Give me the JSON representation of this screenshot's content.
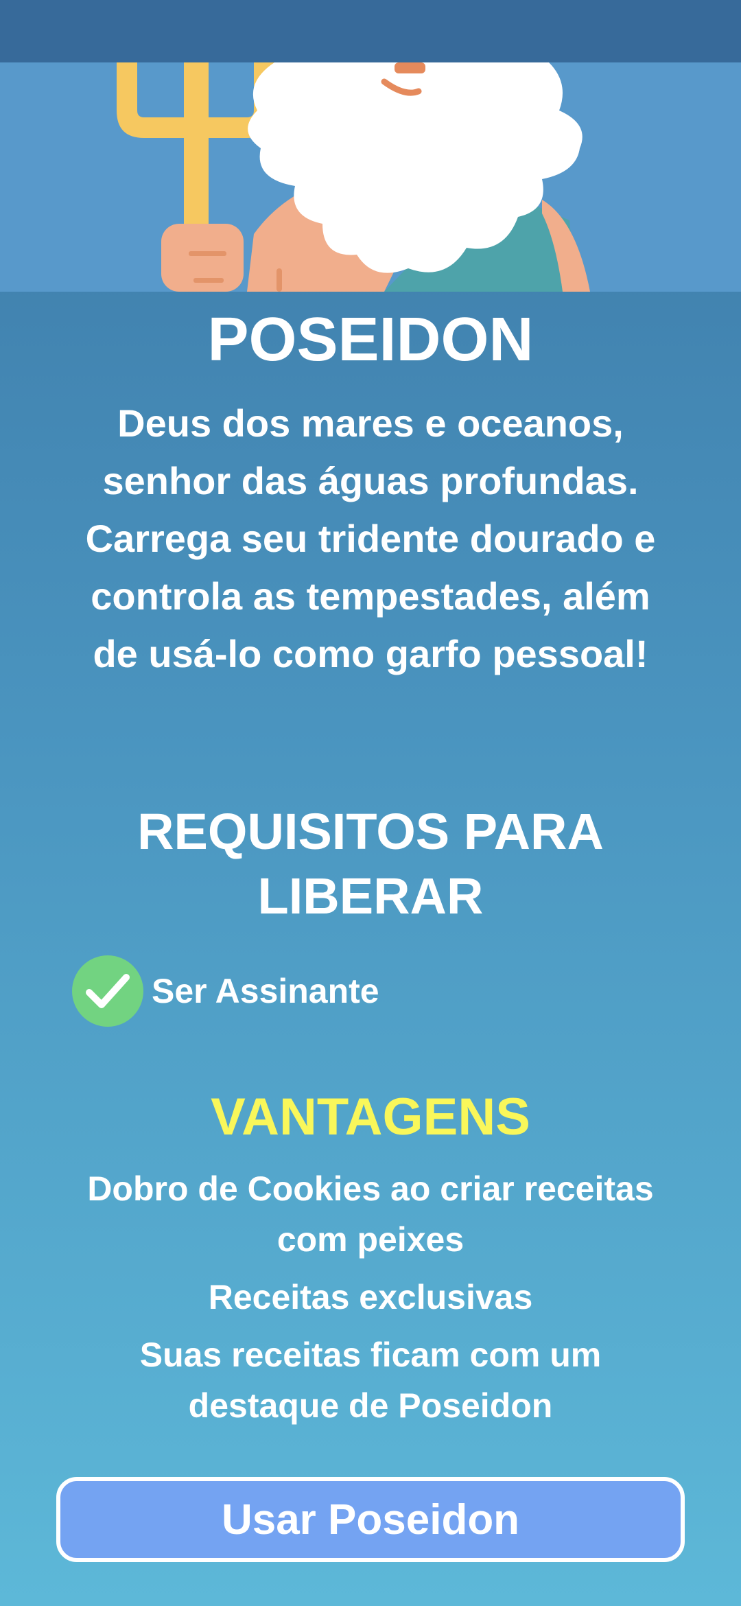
{
  "god": {
    "name": "POSEIDON",
    "description": "Deus dos mares e oceanos, senhor das águas profundas. Carrega seu tridente dourado e controla as tempestades, além de usá-lo como garfo pessoal!"
  },
  "requirements": {
    "title": "REQUISITOS PARA LIBERAR",
    "items": [
      {
        "label": "Ser Assinante",
        "status": "met"
      }
    ]
  },
  "advantages": {
    "title": "VANTAGENS",
    "items": [
      "Dobro de Cookies ao criar receitas com peixes",
      "Receitas exclusivas",
      "Suas receitas ficam com um destaque de Poseidon"
    ]
  },
  "action": {
    "label": "Usar Poseidon"
  },
  "colors": {
    "background_top": "#3c78a6",
    "background_bottom": "#5db8d8",
    "hero_background": "#5899cb",
    "advantages_title": "#f9f75a",
    "check": "#72d381",
    "button": "#74a3f2"
  }
}
